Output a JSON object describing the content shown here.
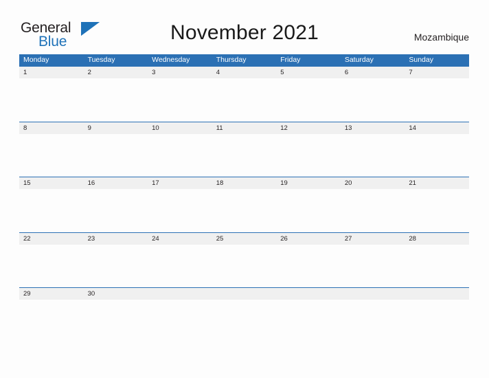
{
  "logo": {
    "text_primary": "General",
    "text_secondary": "Blue",
    "triangle_color": "#1f72b8",
    "primary_color": "#231f20",
    "secondary_color": "#1f72b8",
    "icon": "triangle-flag-icon"
  },
  "header": {
    "title": "November 2021",
    "country": "Mozambique"
  },
  "colors": {
    "header_blue": "#2b70b4",
    "date_strip_gray": "#f0f0f0",
    "page_background": "#fdfdfd",
    "text_dark": "#231f20",
    "weekday_text": "#ffffff"
  },
  "calendar": {
    "month": "November",
    "year": "2021",
    "weekdays": [
      {
        "label": "Monday"
      },
      {
        "label": "Tuesday"
      },
      {
        "label": "Wednesday"
      },
      {
        "label": "Thursday"
      },
      {
        "label": "Friday"
      },
      {
        "label": "Saturday"
      },
      {
        "label": "Sunday"
      }
    ],
    "weeks": [
      {
        "days": [
          "1",
          "2",
          "3",
          "4",
          "5",
          "6",
          "7"
        ]
      },
      {
        "days": [
          "8",
          "9",
          "10",
          "11",
          "12",
          "13",
          "14"
        ]
      },
      {
        "days": [
          "15",
          "16",
          "17",
          "18",
          "19",
          "20",
          "21"
        ]
      },
      {
        "days": [
          "22",
          "23",
          "24",
          "25",
          "26",
          "27",
          "28"
        ]
      },
      {
        "days": [
          "29",
          "30",
          "",
          "",
          "",
          "",
          ""
        ]
      }
    ]
  }
}
